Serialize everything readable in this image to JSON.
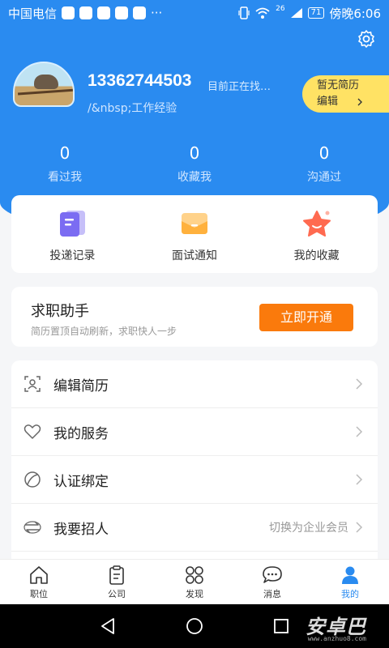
{
  "status_bar": {
    "carrier": "中国电信",
    "more": "···",
    "signal_badge": "26",
    "battery": "71",
    "time": "傍晚6:06"
  },
  "profile": {
    "phone": "13362744503",
    "status": "目前正在找…",
    "experience": "/&nbsp;工作经验",
    "resume_status": "暂无简历",
    "edit_label": "编辑"
  },
  "stats": [
    {
      "value": "0",
      "label": "看过我"
    },
    {
      "value": "0",
      "label": "收藏我"
    },
    {
      "value": "0",
      "label": "沟通过"
    }
  ],
  "quick_actions": [
    {
      "label": "投递记录",
      "icon": "document-icon",
      "color": "#7b6cf2"
    },
    {
      "label": "面试通知",
      "icon": "mail-icon",
      "color": "#ffb13d"
    },
    {
      "label": "我的收藏",
      "icon": "star-icon",
      "color": "#ff6a50"
    }
  ],
  "assistant": {
    "title": "求职助手",
    "subtitle": "简历置顶自动刷新，求职快人一步",
    "button": "立即开通"
  },
  "menu": [
    {
      "label": "编辑简历",
      "icon": "resume-scan-icon",
      "extra": ""
    },
    {
      "label": "我的服务",
      "icon": "heart-icon",
      "extra": ""
    },
    {
      "label": "认证绑定",
      "icon": "leaf-icon",
      "extra": ""
    },
    {
      "label": "我要招人",
      "icon": "switch-icon",
      "extra": "切换为企业会员"
    }
  ],
  "tabs": [
    {
      "label": "职位",
      "icon": "home-icon"
    },
    {
      "label": "公司",
      "icon": "clipboard-icon"
    },
    {
      "label": "发现",
      "icon": "grid-icon"
    },
    {
      "label": "消息",
      "icon": "chat-icon"
    },
    {
      "label": "我的",
      "icon": "person-icon"
    }
  ],
  "watermark": {
    "text": "安卓巴",
    "sub": "www.anzhuo8.com"
  },
  "colors": {
    "primary": "#2a8bf0",
    "accent": "#fa7a0c",
    "pill": "#ffe264"
  }
}
